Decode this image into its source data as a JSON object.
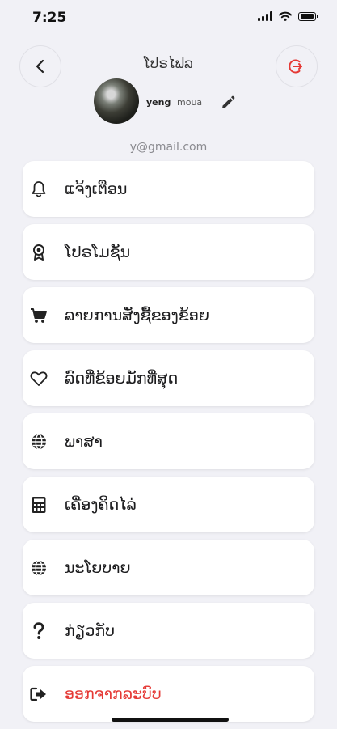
{
  "status_bar": {
    "time": "7:25"
  },
  "header": {
    "title": "ໂປຣໄຟລ"
  },
  "profile": {
    "first_name": "yeng",
    "last_name": "moua",
    "email": "y@gmail.com"
  },
  "menu": {
    "items": [
      {
        "label": "ແຈ້ງເຕືອນ",
        "icon": "bell-icon"
      },
      {
        "label": "ໂປຣໂມຊັນ",
        "icon": "award-icon"
      },
      {
        "label": "ລາຍການສັ່ງຊື້ຂອງຂ້ອຍ",
        "icon": "cart-icon"
      },
      {
        "label": "ລົດທີ່ຂ້ອຍມັກທີ່ສຸດ",
        "icon": "heart-icon"
      },
      {
        "label": "ພາສາ",
        "icon": "globe-icon"
      },
      {
        "label": "ເຄື່ອງຄິດໄລ່",
        "icon": "calculator-icon"
      },
      {
        "label": "ນະໂຍບາຍ",
        "icon": "globe-icon"
      },
      {
        "label": "ກ່ຽວກັບ",
        "icon": "question-icon"
      },
      {
        "label": "ອອກຈາກລະບົບ",
        "icon": "sign-out-icon"
      }
    ]
  },
  "colors": {
    "background": "#f1f1f6",
    "card": "#ffffff",
    "danger": "#e53935"
  }
}
